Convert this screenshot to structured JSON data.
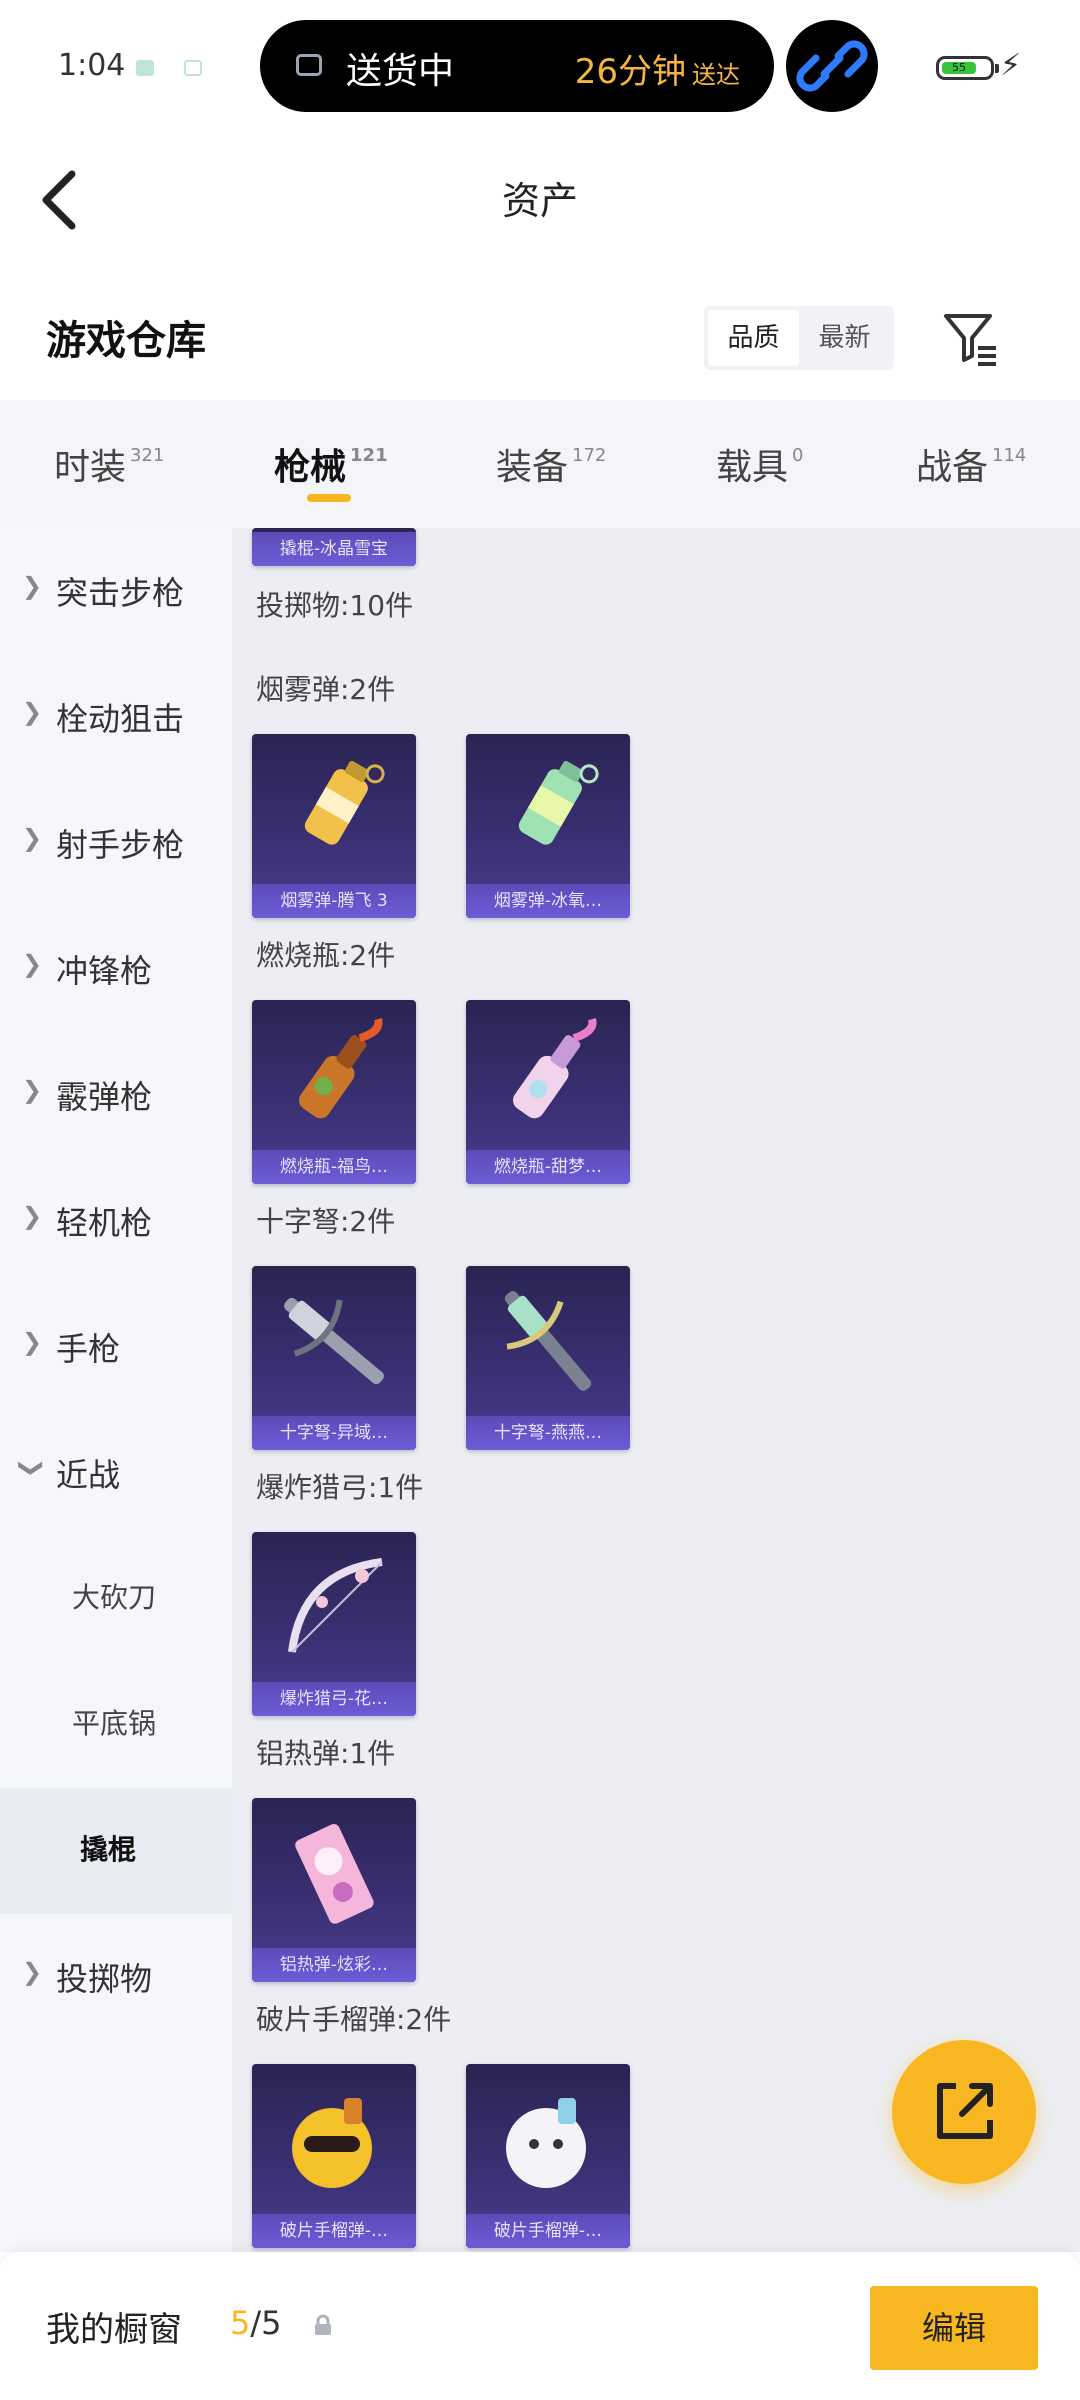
{
  "status_bar": {
    "time": "1:04",
    "delivery_status": "送货中",
    "delivery_eta": "26分钟",
    "delivery_eta_suffix": "送达",
    "battery_level": "55",
    "colors": {
      "eta": "#f5b641",
      "battery": "#37c437"
    }
  },
  "header": {
    "title": "资产",
    "back_icon": "chevron-left-icon"
  },
  "warehouse": {
    "title": "游戏仓库",
    "sort_options": [
      "品质",
      "最新"
    ],
    "sort_selected": "品质",
    "filter_icon": "filter-icon"
  },
  "tabs": [
    {
      "label": "时装",
      "count": "321"
    },
    {
      "label": "枪械",
      "count": "121",
      "active": true
    },
    {
      "label": "装备",
      "count": "172"
    },
    {
      "label": "载具",
      "count": "0"
    },
    {
      "label": "战备",
      "count": "114"
    }
  ],
  "sidebar": {
    "items": [
      {
        "label": "突击步枪",
        "icon": "chevron-right-icon"
      },
      {
        "label": "栓动狙击",
        "icon": "chevron-right-icon"
      },
      {
        "label": "射手步枪",
        "icon": "chevron-right-icon"
      },
      {
        "label": "冲锋枪",
        "icon": "chevron-right-icon"
      },
      {
        "label": "霰弹枪",
        "icon": "chevron-right-icon"
      },
      {
        "label": "轻机枪",
        "icon": "chevron-right-icon"
      },
      {
        "label": "手枪",
        "icon": "chevron-right-icon"
      },
      {
        "label": "近战",
        "icon": "chevron-down-icon"
      },
      {
        "label": "大砍刀"
      },
      {
        "label": "平底锅"
      },
      {
        "label": "撬棍",
        "selected": true
      },
      {
        "label": "投掷物",
        "icon": "chevron-right-icon"
      }
    ]
  },
  "main": {
    "partial_card": "撬棍-冰晶雪宝",
    "sections": [
      {
        "title": "投掷物:10件",
        "items": []
      },
      {
        "title": "烟雾弹:2件",
        "items": [
          "烟雾弹-腾飞 3",
          "烟雾弹-冰氧…"
        ]
      },
      {
        "title": "燃烧瓶:2件",
        "items": [
          "燃烧瓶-福鸟…",
          "燃烧瓶-甜梦…"
        ]
      },
      {
        "title": "十字弩:2件",
        "items": [
          "十字弩-异域…",
          "十字弩-燕燕…"
        ]
      },
      {
        "title": "爆炸猎弓:1件",
        "items": [
          "爆炸猎弓-花…"
        ]
      },
      {
        "title": "铝热弹:1件",
        "items": [
          "铝热弹-炫彩…"
        ]
      },
      {
        "title": "破片手榴弹:2件",
        "items": [
          "破片手榴弹-…",
          "破片手榴弹-…"
        ]
      }
    ]
  },
  "fab": {
    "icon": "share-external-icon",
    "color": "#f8b621"
  },
  "bottom_bar": {
    "label": "我的橱窗",
    "count_current": "5",
    "count_sep": "/",
    "count_total": "5",
    "lock_icon": "lock-icon",
    "edit_label": "编辑",
    "accent": "#f8b621"
  }
}
